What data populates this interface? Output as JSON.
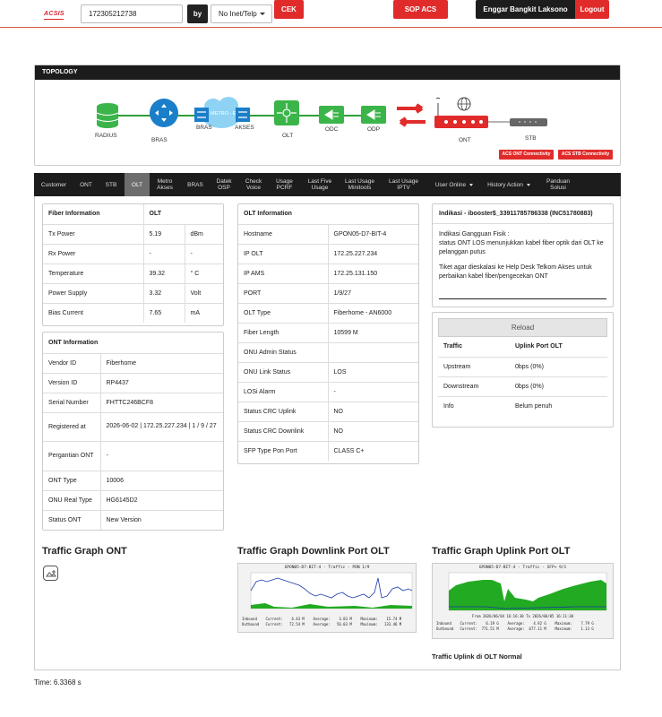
{
  "header": {
    "logo": "ACSIS",
    "search_value": "172305212738",
    "by_label": "by",
    "select_value": "No Inet/Telp",
    "cek_label": "CEK",
    "sop_label": "SOP ACS",
    "user_name": "Enggar Bangkit Laksono",
    "logout_label": "Logout"
  },
  "topology": {
    "title": "TOPOLOGY",
    "nodes": {
      "radius": "RADIUS",
      "bras": "BRAS",
      "bras2": "BRAS",
      "metro": "METRO - E",
      "akses": "AKSES",
      "olt": "OLT",
      "odc": "ODC",
      "odp": "ODP",
      "ont": "ONT",
      "stb": "STB"
    },
    "ont_badge": "ACS ONT Connectivity",
    "stb_badge": "ACS STB Connectivity"
  },
  "tabs": [
    {
      "label": "Customer"
    },
    {
      "label": "ONT"
    },
    {
      "label": "STB"
    },
    {
      "label": "OLT"
    },
    {
      "label": "Metro Akses"
    },
    {
      "label": "BRAS"
    },
    {
      "label": "Datek OSP"
    },
    {
      "label": "Check Voice"
    },
    {
      "label": "Usage PCRF"
    },
    {
      "label": "Last Five Usage"
    },
    {
      "label": "Last Usage Minitools"
    },
    {
      "label": "Last Usage IPTV"
    },
    {
      "label": "User Online"
    },
    {
      "label": "History Action"
    },
    {
      "label": "Panduan Solusi"
    }
  ],
  "fiber": {
    "h1": "Fiber Information",
    "h2": "OLT",
    "rows": [
      {
        "label": "Tx Power",
        "value": "5.19",
        "unit": "dBm"
      },
      {
        "label": "Rx Power",
        "value": "-",
        "unit": "-"
      },
      {
        "label": "Temperature",
        "value": "39.32",
        "unit": "° C"
      },
      {
        "label": "Power Supply",
        "value": "3.32",
        "unit": "Volt"
      },
      {
        "label": "Bias Current",
        "value": "7.65",
        "unit": "mA"
      }
    ]
  },
  "ont_info": {
    "title": "ONT Information",
    "rows": [
      {
        "label": "Vendor ID",
        "value": "Fiberhome"
      },
      {
        "label": "Version ID",
        "value": "RP4437"
      },
      {
        "label": "Serial Number",
        "value": "FHTTC246BCF8"
      },
      {
        "label": "Registered at",
        "value": "2026-06-02 | 172.25.227.234 | 1 / 9 / 27"
      },
      {
        "label": "Pergantian ONT",
        "value": "-"
      },
      {
        "label": "ONT Type",
        "value": "10006"
      },
      {
        "label": "ONU Real Type",
        "value": "HG6145D2"
      },
      {
        "label": "Status ONT",
        "value": "New Version"
      }
    ]
  },
  "olt_info": {
    "title": "OLT Information",
    "rows": [
      {
        "label": "Hostname",
        "value": "GPON05-D7-BIT-4"
      },
      {
        "label": "IP OLT",
        "value": "172.25.227.234"
      },
      {
        "label": "IP AMS",
        "value": "172.25.131.150"
      },
      {
        "label": "PORT",
        "value": "1/9/27"
      },
      {
        "label": "OLT Type",
        "value": "Fiberhome - AN6000"
      },
      {
        "label": "Fiber Length",
        "value": "10599 M"
      },
      {
        "label": "ONU Admin Status",
        "value": ""
      },
      {
        "label": "ONU Link Status",
        "value": "LOS"
      },
      {
        "label": "LOSi Alarm",
        "value": "-"
      },
      {
        "label": "Status CRC Uplink",
        "value": "NO"
      },
      {
        "label": "Status CRC Downlink",
        "value": "NO"
      },
      {
        "label": "SFP Type Pon Port",
        "value": "CLASS C+"
      }
    ]
  },
  "indikasi": {
    "title": "Indikasi - ibooster$_33911785786338 (INC51780883)",
    "line1": "Indikasi Gangguan Fisik :",
    "line2": "status ONT LOS menunjukkan kabel fiber optik dari OLT ke pelanggan putus",
    "line3": "Tiket agar dieskalasi ke Help Desk Telkom Akses untuk perbaikan kabel fiber/pengecekan ONT"
  },
  "traffic": {
    "reload_label": "Reload",
    "h1": "Traffic",
    "h2": "Uplink Port OLT",
    "rows": [
      {
        "label": "Upstream",
        "value": "0bps (0%)"
      },
      {
        "label": "Downstream",
        "value": "0bps (0%)"
      },
      {
        "label": "Info",
        "value": "Belum penuh"
      }
    ]
  },
  "graphs": {
    "ont_title": "Traffic Graph ONT",
    "downlink_title": "Traffic Graph Downlink Port OLT",
    "uplink_title": "Traffic Graph Uplink Port OLT",
    "downlink_caption": "GPON05-D7-BIT-4 - Traffic - PON 1/9",
    "uplink_caption": "GPON05-D7-BIT-4 - Traffic - SFP+ 9/1",
    "downlink_legend_in": "Inbound    Current:    4.43 M    Average:    3.83 M    Maximum:    15.74 M",
    "downlink_legend_out": "Outbound   Current:   72.54 M    Average:   56.03 M    Maximum:   133.46 M",
    "uplink_legend_in": "Inbound    Current:    6.19 G    Average:    4.92 G    Maximum:    7.79 G",
    "uplink_legend_out": "Outbound   Current:  771.51 M    Average:  677.11 M    Maximum:    1.13 G",
    "uplink_range": "From 2026/06/04 16:16:30 To 2026/06/05 16:11:30",
    "uplink_status": "Traffic Uplink di OLT Normal",
    "colors": {
      "inbound": "#22aa22",
      "outbound": "#1a3aa8"
    }
  },
  "footer": {
    "time": "Time: 6.3368 s"
  }
}
